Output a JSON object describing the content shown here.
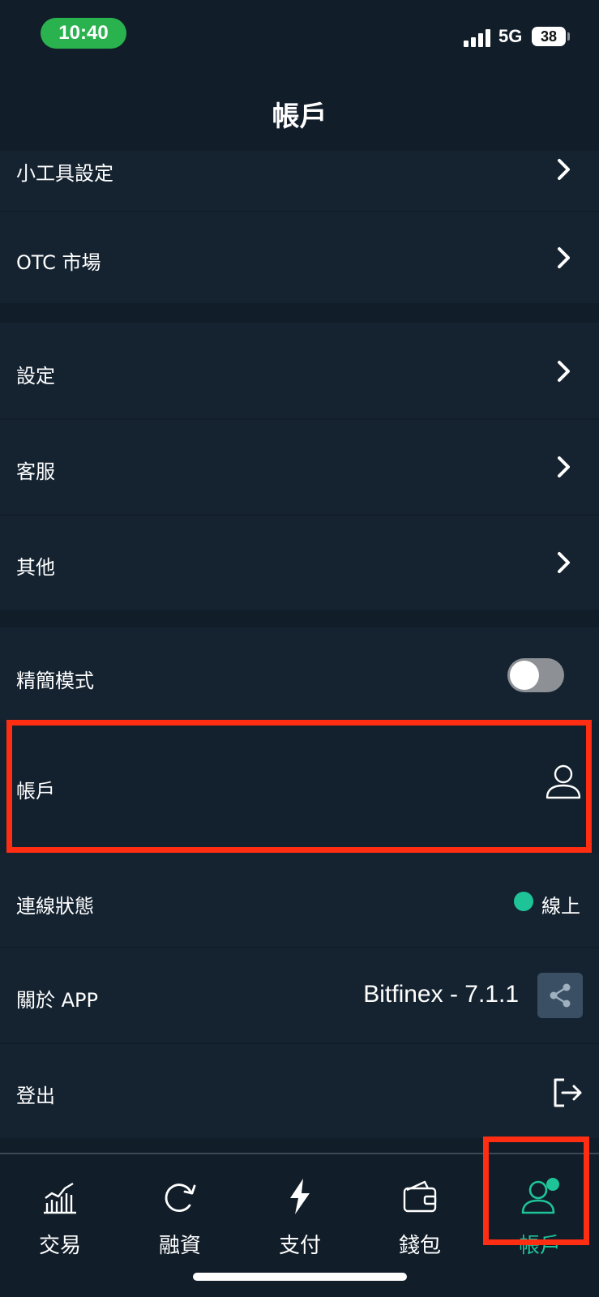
{
  "status_bar": {
    "time": "10:40",
    "network": "5G",
    "battery": "38"
  },
  "header": {
    "title": "帳戶"
  },
  "menu": {
    "widget_settings": "小工具設定",
    "otc_market": "OTC 市場",
    "settings": "設定",
    "customer_service": "客服",
    "other": "其他",
    "lite_mode": "精簡模式",
    "lite_mode_enabled": false,
    "account": "帳戶",
    "connection_status": "連線狀態",
    "connection_value": "線上",
    "about_app": "關於 APP",
    "app_version": "Bitfinex - 7.1.1",
    "logout": "登出"
  },
  "tabs": [
    {
      "label": "交易",
      "icon": "chart-icon",
      "active": false
    },
    {
      "label": "融資",
      "icon": "refresh-icon",
      "active": false
    },
    {
      "label": "支付",
      "icon": "lightning-icon",
      "active": false
    },
    {
      "label": "錢包",
      "icon": "wallet-icon",
      "active": false
    },
    {
      "label": "帳戶",
      "icon": "account-icon",
      "active": true
    }
  ],
  "colors": {
    "background": "#111d29",
    "row": "#152331",
    "accent": "#1ec498",
    "highlight": "#ff2d12"
  }
}
